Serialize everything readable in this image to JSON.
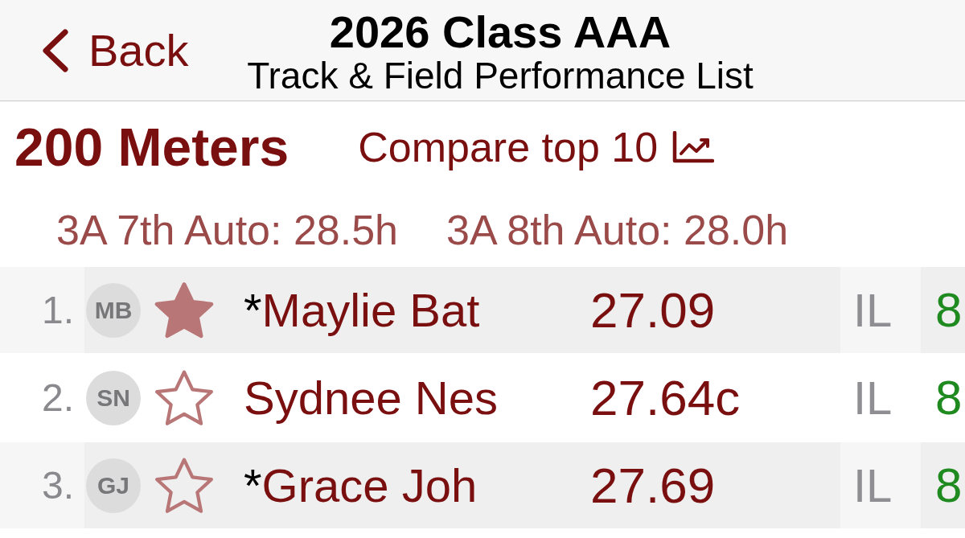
{
  "header": {
    "back_label": "Back",
    "title": "2026 Class AAA",
    "subtitle": "Track & Field Performance List"
  },
  "event": {
    "title": "200 Meters",
    "compare_label": "Compare top 10"
  },
  "standards": [
    "3A 7th Auto: 28.5h",
    "3A 8th Auto: 28.0h"
  ],
  "rows": [
    {
      "rank": "1.",
      "initials": "MB",
      "starred": true,
      "marker": "*",
      "name": "Maylie Bat",
      "time": "27.09",
      "column_6": "IL",
      "column_7": "8"
    },
    {
      "rank": "2.",
      "initials": "SN",
      "starred": false,
      "name": "Sydnee Nes",
      "time": "27.64c",
      "column_6": "IL",
      "column_7": "8"
    },
    {
      "rank": "3.",
      "initials": "GJ",
      "starred": false,
      "marker": "*",
      "name": "Grace Joh",
      "time": "27.69",
      "column_6": "IL",
      "column_7": "8"
    }
  ]
}
